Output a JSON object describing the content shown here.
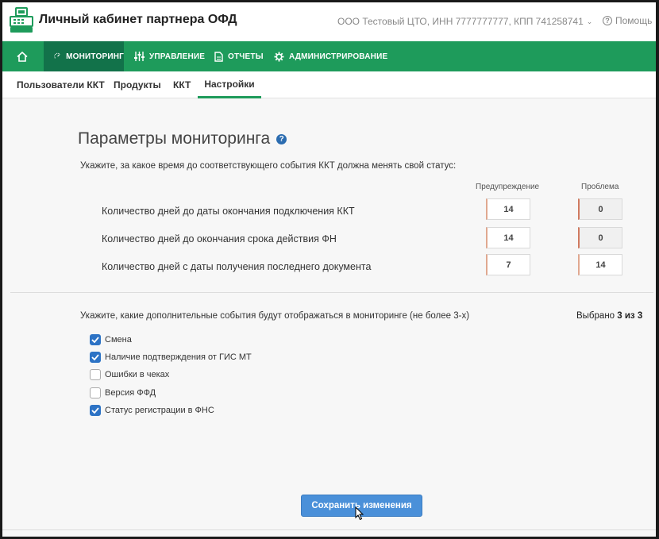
{
  "header": {
    "app_title": "Личный кабинет партнера ОФД",
    "org_selector": "ООО Тестовый ЦТО, ИНН 7777777777, КПП 741258741",
    "help_label": "Помощь"
  },
  "nav": {
    "items": [
      {
        "label": "",
        "icon": "home-icon"
      },
      {
        "label": "МОНИТОРИНГ",
        "icon": "monitoring-icon",
        "active": true
      },
      {
        "label": "УПРАВЛЕНИЕ",
        "icon": "sliders-icon"
      },
      {
        "label": "ОТЧЕТЫ",
        "icon": "document-icon"
      },
      {
        "label": "АДМИНИСТРИРОВАНИЕ",
        "icon": "gear-icon"
      }
    ]
  },
  "subnav": {
    "items": [
      {
        "label": "Пользователи ККТ"
      },
      {
        "label": "Продукты"
      },
      {
        "label": "ККТ"
      },
      {
        "label": "Настройки",
        "active": true
      }
    ]
  },
  "settings": {
    "title": "Параметры мониторинга",
    "intro": "Укажите, за какое время до соответствующего события ККТ должна менять свой статус:",
    "col_warning": "Предупреждение",
    "col_problem": "Проблема",
    "rows": [
      {
        "label": "Количество дней до даты окончания подключения ККТ",
        "warning": "14",
        "problem": "0"
      },
      {
        "label": "Количество дней до окончания срока действия ФН",
        "warning": "14",
        "problem": "0"
      },
      {
        "label": "Количество дней с даты получения последнего документа",
        "warning": "7",
        "problem": "14"
      }
    ]
  },
  "events": {
    "prompt": "Укажите, какие дополнительные события будут отображаться в мониторинге (не более 3-х)",
    "selected_prefix": "Выбрано",
    "selected_count": "3 из 3",
    "items": [
      {
        "label": "Смена",
        "checked": true
      },
      {
        "label": "Наличие подтверждения от ГИС МТ",
        "checked": true
      },
      {
        "label": "Ошибки в чеках",
        "checked": false
      },
      {
        "label": "Версия ФФД",
        "checked": false
      },
      {
        "label": "Статус регистрации в ФНС",
        "checked": true
      }
    ]
  },
  "save_button": "Сохранить изменения",
  "colors": {
    "accent_green": "#1e9b5b",
    "accent_green_dark": "#12724a",
    "checkbox_blue": "#2d73c5",
    "button_blue": "#4a90d9"
  }
}
